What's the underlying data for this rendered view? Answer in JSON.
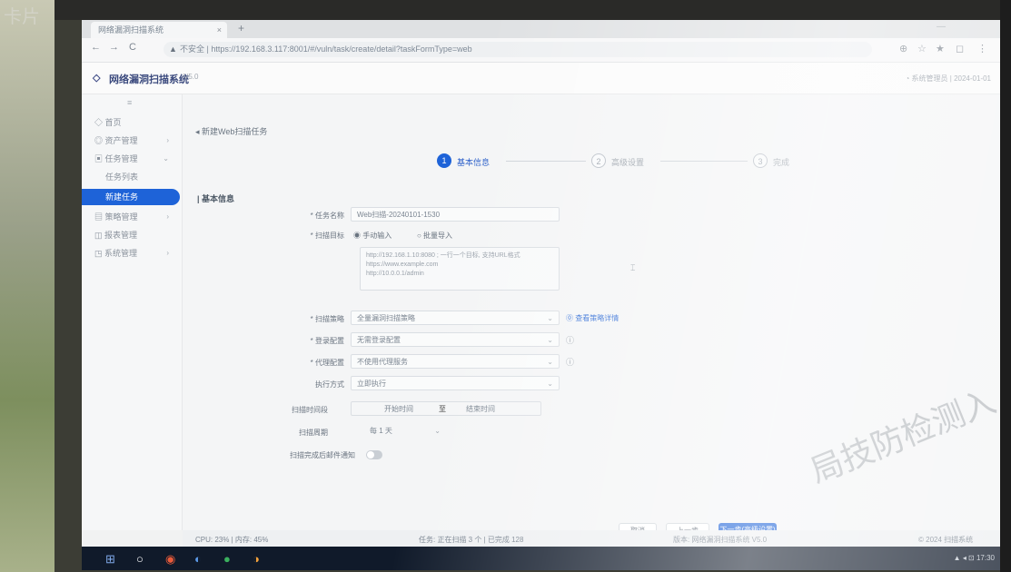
{
  "photo": {
    "wall_text": "卡片"
  },
  "browser": {
    "tab_title": "网络漏洞扫描系统",
    "tab_close": "×",
    "new_tab": "+",
    "back": "←",
    "forward": "→",
    "reload": "C",
    "secure_label": "不安全",
    "url": "https://192.168.3.117:8001/#/vuln/task/create/detail?taskFormType=web",
    "tool_icons": [
      "⊕",
      "☆",
      "★",
      "◻",
      "⋮"
    ]
  },
  "app": {
    "logo": "◇",
    "title": "网络漏洞扫描系统",
    "version": "V5.0",
    "user": "◔ 系统管理员 | 2024-01-01"
  },
  "sidebar": {
    "collapse": "≡",
    "items": [
      {
        "label": "◇ 首页",
        "arrow": ""
      },
      {
        "label": "◎ 资产管理",
        "arrow": "›"
      },
      {
        "label": "▣ 任务管理",
        "arrow": "⌄"
      },
      {
        "label": "任务列表",
        "arrow": ""
      },
      {
        "label": "新建任务",
        "arrow": ""
      },
      {
        "label": "▤ 策略管理",
        "arrow": "›"
      },
      {
        "label": "◫ 报表管理",
        "arrow": ""
      },
      {
        "label": "◳ 系统管理",
        "arrow": "›"
      }
    ]
  },
  "main": {
    "breadcrumb": "◂ 新建Web扫描任务",
    "steps": [
      {
        "num": "1",
        "label": "基本信息"
      },
      {
        "num": "2",
        "label": "高级设置"
      },
      {
        "num": "3",
        "label": "完成"
      }
    ],
    "section_title": "| 基本信息",
    "form": {
      "task_name_label": "* 任务名称",
      "task_name_value": "Web扫描-20240101-1530",
      "target_label": "* 扫描目标",
      "target_opt1": "◉ 手动输入",
      "target_opt2": "○ 批量导入",
      "target_lines": [
        "http://192.168.1.10:8080 ; 一行一个目标, 支持URL格式",
        "https://www.example.com",
        "http://10.0.0.1/admin"
      ],
      "strategy_label": "* 扫描策略",
      "strategy_value": "全量漏洞扫描策略",
      "strategy_link": "⓪ 查看策略详情",
      "login_label": "* 登录配置",
      "login_value": "无需登录配置",
      "proxy_label": "* 代理配置",
      "proxy_value": "不使用代理服务",
      "exec_label": "执行方式",
      "exec_value": "立即执行",
      "time_label": "扫描时间段",
      "time_start": "开始时间",
      "time_sep": "至",
      "time_end": "结束时间",
      "period_label": "扫描周期",
      "period_value": "每 1 天",
      "notify_label": "扫描完成后邮件通知",
      "caret": "⌄",
      "info_icon": "ⓘ"
    },
    "buttons": {
      "cancel": "取消",
      "prev": "上一步",
      "next": "下一步(高级设置)"
    }
  },
  "statusbar": {
    "left": "CPU: 23% | 内存: 45%",
    "middle": "任务: 正在扫描 3 个 | 已完成 128",
    "right": "版本: 网络漏洞扫描系统 V5.0",
    "far": "© 2024 扫描系统"
  },
  "taskbar": {
    "icons": [
      "⊞",
      "○",
      "◉",
      "◐",
      "●",
      "◑"
    ],
    "tray": "▲ ◂ ⊡ 17:30"
  },
  "watermark": "局技防检测入"
}
